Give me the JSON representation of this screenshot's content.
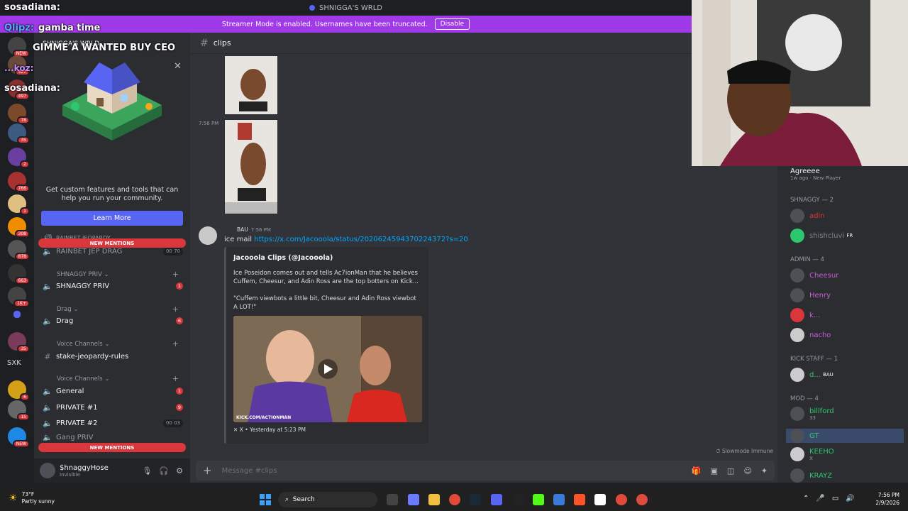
{
  "window_title": "SHNIGGA'S WRLD",
  "banner": {
    "text": "Streamer Mode is enabled. Usernames have been truncated.",
    "button": "Disable"
  },
  "rail": {
    "badges": [
      "NEW",
      "427",
      "497",
      "78",
      "35",
      "2",
      "766",
      "1",
      "308",
      "878",
      "663",
      "1K+",
      "35",
      "6",
      "15",
      "NEW"
    ],
    "sxk": "SXK"
  },
  "overlay": [
    {
      "name": "sosadiana:",
      "text": ""
    },
    {
      "name": "Qlipz:",
      "text": "gamba time"
    },
    {
      "name": "",
      "text": "GIMME A WANTED BUY CEO"
    },
    {
      "name": "...koz:",
      "text": ""
    },
    {
      "name": "sosadiana:",
      "text": ""
    }
  ],
  "sidebar": {
    "guild": "SHNIGGA'S WRLD",
    "promo_text": "Get custom features and tools that can help you run your community.",
    "learn_more": "Learn More",
    "new_mentions": "NEW MENTIONS",
    "cut_channel": "RAINBET JEOPARDY",
    "channels": [
      {
        "type": "channel",
        "name": "RAINBET JEP DRAG",
        "pill": "00  70"
      },
      {
        "type": "category",
        "name": "SHNAGGY PRIV"
      },
      {
        "type": "channel",
        "name": "SHNAGGY PRIV",
        "count": "1"
      },
      {
        "type": "category",
        "name": "Drag"
      },
      {
        "type": "channel",
        "name": "Drag",
        "count": "6"
      },
      {
        "type": "category",
        "name": "Voice Channels"
      },
      {
        "type": "text",
        "name": "stake-jeopardy-rules"
      },
      {
        "type": "category",
        "name": "Voice Channels"
      },
      {
        "type": "channel",
        "name": "General",
        "count": "1"
      },
      {
        "type": "channel",
        "name": "PRIVATE #1",
        "count": "9"
      },
      {
        "type": "channel",
        "name": "PRIVATE #2",
        "pill": "00  03"
      },
      {
        "type": "channel",
        "name": "Gang PRIV"
      }
    ],
    "user": {
      "name": "$hnaggyHose",
      "status": "Invisible"
    }
  },
  "chat": {
    "channel": "clips",
    "timestamp1": "7:56 PM",
    "message": {
      "tag": "BAU",
      "time": "7:56 PM",
      "prefix": "ice mail",
      "link": "https://x.com/Jacooola/status/2020624594370224372?s=20"
    },
    "embed": {
      "author": "Jacooola Clips (@Jacooola)",
      "desc1": "Ice Poseidon comes out and tells Ac7ionMan that he believes Cuffem, Cheesur, and Adin Ross are the top botters on Kick...",
      "desc2": "\"Cuffem viewbots a little bit, Cheesur and Adin Ross viewbot A LOT!\"",
      "thumb_caption": "KICK.COM/AC7IONMAN",
      "footer": "X • Yesterday at 5:23 PM"
    },
    "slowmode": "Slowmode Immune",
    "placeholder": "Message #clips"
  },
  "members": {
    "top": {
      "name": "Agreeee",
      "sub": "1w ago · New Player"
    },
    "groups": [
      {
        "label": "SHNAGGY — 2",
        "items": [
          {
            "name": "adin",
            "color": "#da373c"
          },
          {
            "name": "shishcluvi",
            "color": "#2b2d31",
            "tag": "FR"
          }
        ]
      },
      {
        "label": "ADMIN — 4",
        "items": [
          {
            "name": "Cheesur",
            "color": "#c95bdb"
          },
          {
            "name": "Henry",
            "color": "#c95bdb"
          },
          {
            "name": "k...",
            "color": "#c95bdb"
          },
          {
            "name": "nacho",
            "color": "#c95bdb"
          }
        ]
      },
      {
        "label": "KICK STAFF — 1",
        "items": [
          {
            "name": "d...",
            "color": "#2dc770",
            "tag": "BAU"
          }
        ]
      },
      {
        "label": "MOD — 4",
        "items": [
          {
            "name": "billford",
            "color": "#2dc770",
            "sub": "33"
          },
          {
            "name": "GT",
            "color": "#2dc770"
          },
          {
            "name": "KEEHO",
            "color": "#2dc770",
            "sub": "X"
          },
          {
            "name": "KRAYZ",
            "color": "#2dc770"
          }
        ]
      }
    ]
  },
  "taskbar": {
    "temp": "73°F",
    "weather": "Partly sunny",
    "search": "Search",
    "time": "7:56 PM",
    "date": "2/9/2026"
  }
}
